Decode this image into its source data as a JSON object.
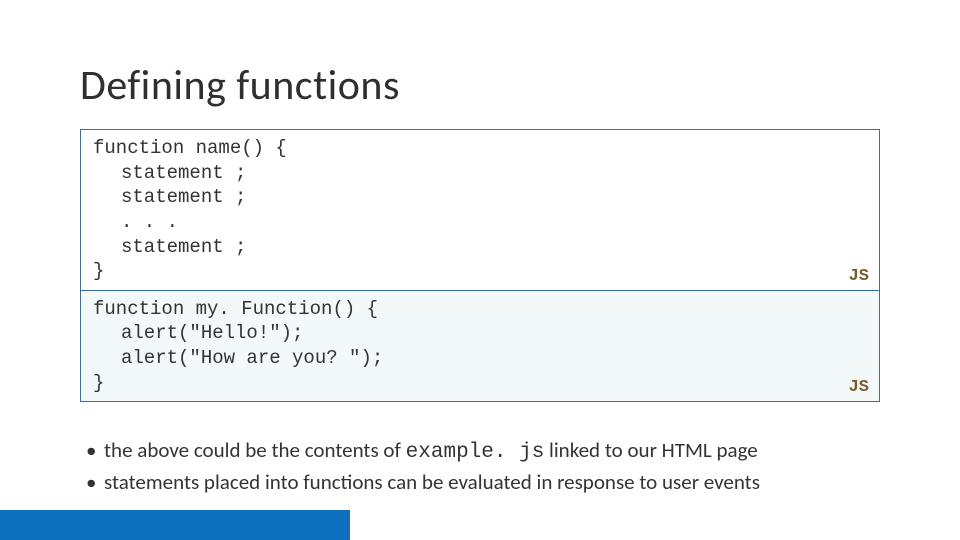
{
  "title": "Defining functions",
  "codeBlocks": [
    {
      "bg": "syntax",
      "lang": "JS",
      "lines": [
        {
          "indent": false,
          "text": "function name() {"
        },
        {
          "indent": true,
          "text": "statement ;"
        },
        {
          "indent": true,
          "text": "statement ;"
        },
        {
          "indent": true,
          "text": ". . ."
        },
        {
          "indent": true,
          "text": "statement ;"
        },
        {
          "indent": false,
          "text": "}"
        }
      ]
    },
    {
      "bg": "example",
      "lang": "JS",
      "lines": [
        {
          "indent": false,
          "text": "function my. Function() {"
        },
        {
          "indent": true,
          "text": "alert(\"Hello!\");"
        },
        {
          "indent": true,
          "text": "alert(\"How are you? \");"
        },
        {
          "indent": false,
          "text": "}"
        }
      ]
    }
  ],
  "bullets": [
    {
      "pre": "the above could be the contents of ",
      "code": "example. js",
      "post": " linked to our HTML page"
    },
    {
      "pre": "statements placed into functions can be evaluated in response to user events",
      "code": "",
      "post": ""
    }
  ]
}
